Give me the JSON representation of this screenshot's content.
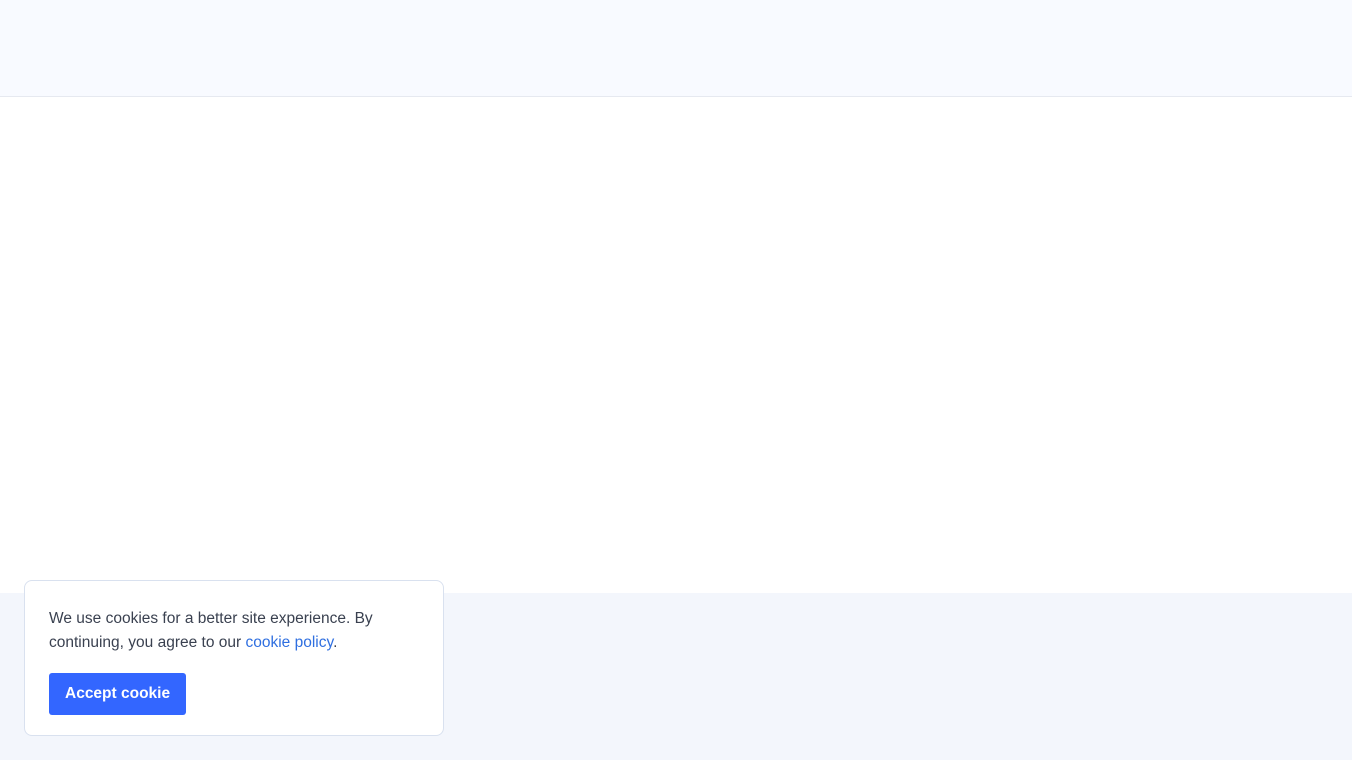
{
  "cookie_banner": {
    "message_before_link": "We use cookies for a better site experience. By continuing, you agree to our ",
    "policy_link_label": "cookie policy",
    "message_after_link": ".",
    "accept_button_label": "Accept cookie"
  },
  "colors": {
    "accent": "#3366ff",
    "link": "#2f6fe0",
    "header_background": "#f8faff",
    "footer_background": "#f3f6fc"
  }
}
